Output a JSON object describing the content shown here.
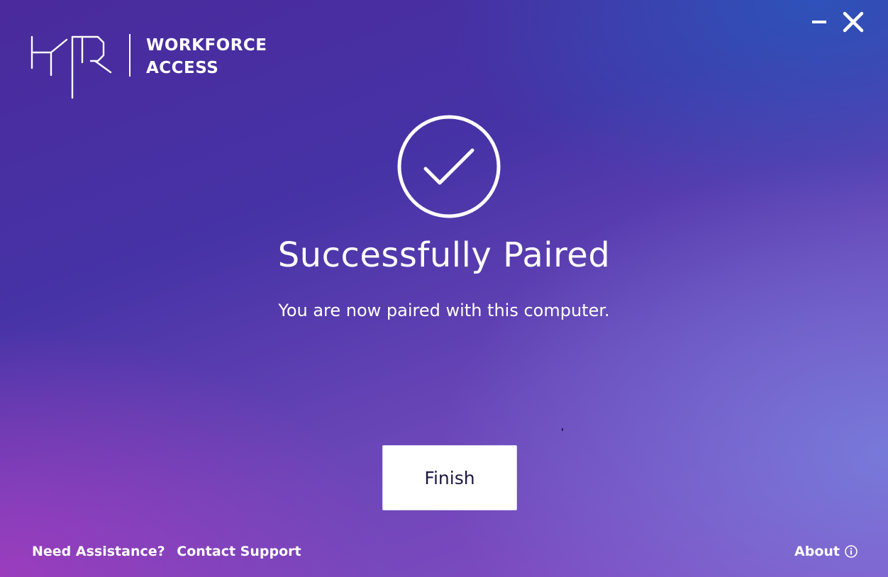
{
  "app": {
    "logo_text": "HYPR",
    "product_line1": "WORKFORCE",
    "product_line2": "ACCESS"
  },
  "window_controls": {
    "minimize_icon": "minimize-icon",
    "close_icon": "close-icon"
  },
  "status": {
    "icon": "check-circle-icon",
    "title": "Successfully Paired",
    "message": "You are now paired with this computer."
  },
  "actions": {
    "finish_label": "Finish"
  },
  "footer": {
    "assist_text": "Need Assistance?",
    "support_link": "Contact Support",
    "about_label": "About",
    "about_icon": "info-icon"
  },
  "colors": {
    "background_top": "#4633a6",
    "background_bottom": "#8a4cc4",
    "button_bg": "#ffffff",
    "button_text": "#1d1640",
    "text": "#ffffff"
  }
}
